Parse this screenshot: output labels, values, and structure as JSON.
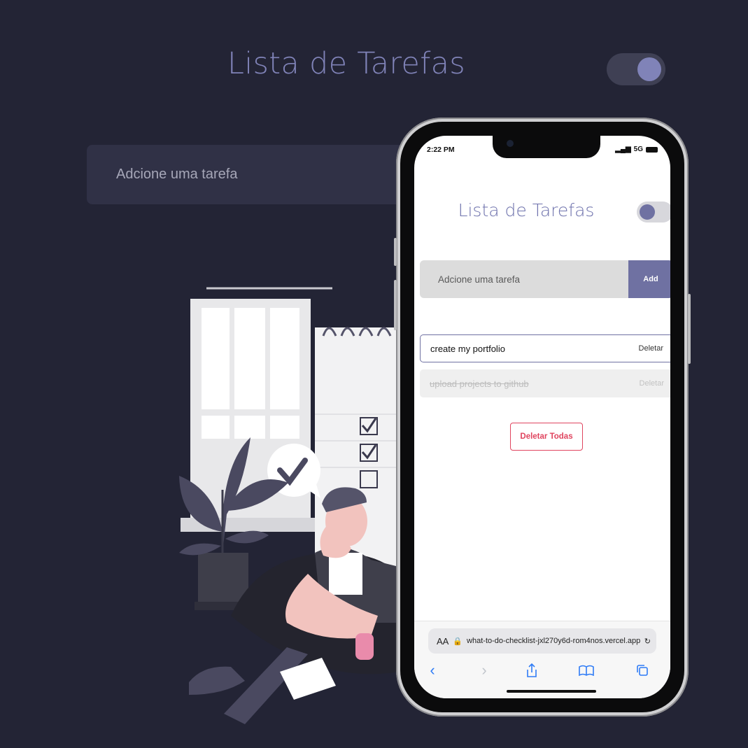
{
  "desktop": {
    "title": "Lista de Tarefas",
    "input_placeholder": "Adcione uma tarefa",
    "theme_toggle_on": true
  },
  "mobile": {
    "status": {
      "time": "2:22 PM",
      "signal": "5G"
    },
    "title": "Lista de Tarefas",
    "input_placeholder": "Adcione uma tarefa",
    "add_label": "Add",
    "tasks": [
      {
        "text": "create my portfolio",
        "delete_label": "Deletar",
        "done": false
      },
      {
        "text": "upload projects to github",
        "delete_label": "Deletar",
        "done": true
      }
    ],
    "delete_all_label": "Deletar Todas",
    "browser": {
      "aa_label": "AA",
      "url": "what-to-do-checklist-jxl270y6d-rom4nos.vercel.app"
    }
  },
  "colors": {
    "background": "#232435",
    "accent": "#8083b8",
    "mobile_accent": "#6f71a2",
    "danger": "#e0455f"
  }
}
